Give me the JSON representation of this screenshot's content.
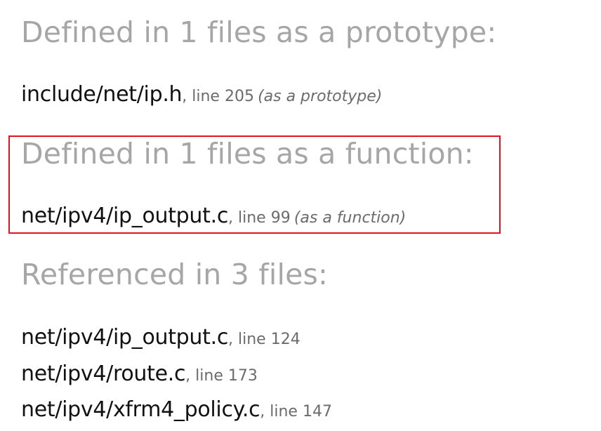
{
  "prototype_section": {
    "heading": "Defined in 1 files as a prototype:",
    "entries": [
      {
        "file": "include/net/ip.h",
        "line": ", line 205",
        "kind": "(as a prototype)"
      }
    ]
  },
  "function_section": {
    "heading": "Defined in 1 files as a function:",
    "entries": [
      {
        "file": "net/ipv4/ip_output.c",
        "line": ", line 99",
        "kind": "(as a function)"
      }
    ]
  },
  "referenced_section": {
    "heading": "Referenced in 3 files:",
    "entries": [
      {
        "file": "net/ipv4/ip_output.c",
        "line": ", line 124"
      },
      {
        "file": "net/ipv4/route.c",
        "line": ", line 173"
      },
      {
        "file": "net/ipv4/xfrm4_policy.c",
        "line": ", line 147"
      }
    ]
  },
  "colors": {
    "heading": "#a6a6a6",
    "link": "#111111",
    "meta": "#6b6b6b",
    "highlight": "#e0141e"
  }
}
